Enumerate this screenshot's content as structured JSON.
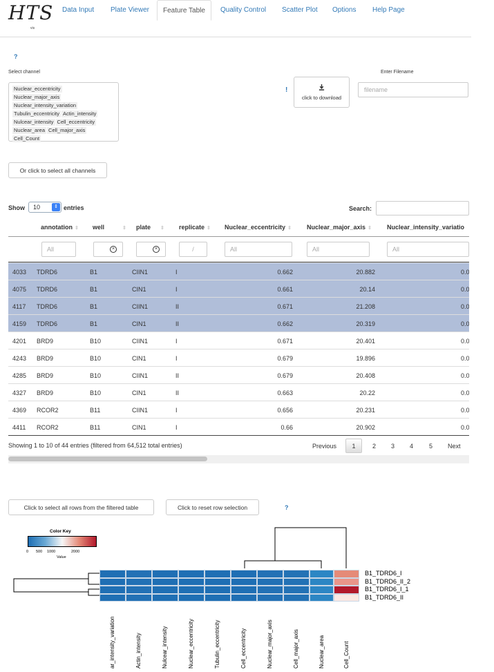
{
  "logo": {
    "main": "HTS",
    "sub": "vis"
  },
  "nav": {
    "items": [
      "Data Input",
      "Plate Viewer",
      "Feature Table",
      "Quality Control",
      "Scatter Plot",
      "Options",
      "Help Page"
    ],
    "active": "Feature Table"
  },
  "help": {
    "q1": "?",
    "q2": "?",
    "bang": "!"
  },
  "channel": {
    "label": "Select channel",
    "options": [
      "Nuclear_eccentricity",
      "Nuclear_major_axis",
      "Nuclear_intensity_variation",
      "Tubulin_eccentricity",
      "Actin_intensity",
      "Nulcear_intensity",
      "Cell_eccentricity",
      "Nuclear_area",
      "Cell_major_axis",
      "Cell_Count"
    ]
  },
  "download": {
    "label": "click to download",
    "icon": "download-icon"
  },
  "filename": {
    "label": "Enter Filename",
    "placeholder": "filename"
  },
  "select_all_channels": "Or click to select all channels",
  "table": {
    "show_label": "Show",
    "length_value": "10",
    "entries_label": "entries",
    "search_label": "Search:",
    "columns": [
      "annotation",
      "well",
      "plate",
      "replicate",
      "Nuclear_eccentricity",
      "Nuclear_major_axis",
      "Nuclear_intensity_variatio"
    ],
    "filters": [
      "All",
      "",
      "",
      "/",
      "All",
      "All",
      "All"
    ],
    "rows": [
      {
        "id": "4033",
        "annotation": "TDRD6",
        "well": "B1",
        "plate": "CIIN1",
        "replicate": "I",
        "ecc": "0.662",
        "major": "20.882",
        "var": "0.0",
        "selected": true
      },
      {
        "id": "4075",
        "annotation": "TDRD6",
        "well": "B1",
        "plate": "CIN1",
        "replicate": "I",
        "ecc": "0.661",
        "major": "20.14",
        "var": "0.0",
        "selected": true
      },
      {
        "id": "4117",
        "annotation": "TDRD6",
        "well": "B1",
        "plate": "CIIN1",
        "replicate": "II",
        "ecc": "0.671",
        "major": "21.208",
        "var": "0.0",
        "selected": true
      },
      {
        "id": "4159",
        "annotation": "TDRD6",
        "well": "B1",
        "plate": "CIN1",
        "replicate": "II",
        "ecc": "0.662",
        "major": "20.319",
        "var": "0.0",
        "selected": true
      },
      {
        "id": "4201",
        "annotation": "BRD9",
        "well": "B10",
        "plate": "CIIN1",
        "replicate": "I",
        "ecc": "0.671",
        "major": "20.401",
        "var": "0.0",
        "selected": false
      },
      {
        "id": "4243",
        "annotation": "BRD9",
        "well": "B10",
        "plate": "CIN1",
        "replicate": "I",
        "ecc": "0.679",
        "major": "19.896",
        "var": "0.0",
        "selected": false
      },
      {
        "id": "4285",
        "annotation": "BRD9",
        "well": "B10",
        "plate": "CIIN1",
        "replicate": "II",
        "ecc": "0.679",
        "major": "20.408",
        "var": "0.0",
        "selected": false
      },
      {
        "id": "4327",
        "annotation": "BRD9",
        "well": "B10",
        "plate": "CIN1",
        "replicate": "II",
        "ecc": "0.663",
        "major": "20.22",
        "var": "0.0",
        "selected": false
      },
      {
        "id": "4369",
        "annotation": "RCOR2",
        "well": "B11",
        "plate": "CIIN1",
        "replicate": "I",
        "ecc": "0.656",
        "major": "20.231",
        "var": "0.0",
        "selected": false
      },
      {
        "id": "4411",
        "annotation": "RCOR2",
        "well": "B11",
        "plate": "CIN1",
        "replicate": "I",
        "ecc": "0.66",
        "major": "20.902",
        "var": "0.0",
        "selected": false
      }
    ],
    "info": "Showing 1 to 10 of 44 entries (filtered from 64,512 total entries)",
    "pagination": {
      "previous": "Previous",
      "pages": [
        "1",
        "2",
        "3",
        "4",
        "5"
      ],
      "current": "1",
      "next": "Next"
    }
  },
  "row_buttons": {
    "select_all": "Click to select all rows from the filtered table",
    "reset": "Click to reset row selection"
  },
  "chart_data": {
    "type": "heatmap",
    "color_key": {
      "title": "Color Key",
      "xlabel": "Value",
      "ticks": [
        "0",
        "500",
        "1000",
        "2000"
      ],
      "range": [
        0,
        2500
      ],
      "low_color": "#1f6fb4",
      "mid_color": "#f7f7f7",
      "high_color": "#b2182b"
    },
    "columns": [
      "Nuclear_intensity_variation",
      "Actin_intensity",
      "Nulcear_intensity",
      "Nuclear_eccentricity",
      "Tubulin_eccentricity",
      "Cell_eccentricity",
      "Nuclear_major_axis",
      "Cell_major_axis",
      "Nuclear_area",
      "Cell_Count"
    ],
    "column_labels": [
      "ar_intensity_variation",
      "Actin_intensity",
      "Nulcear_intensity",
      "Nuclear_eccentricity",
      "Tubulin_eccentricity",
      "Cell_eccentricity",
      "Nuclear_major_axis",
      "Cell_major_axis",
      "Nuclear_area",
      "Cell_Count"
    ],
    "rows": [
      "B1_TDRD6_I",
      "B1_TDRD6_II_2",
      "B1_TDRD6_I_1",
      "B1_TDRD6_II"
    ],
    "values": [
      [
        0.7,
        20.9,
        1,
        0.66,
        0.7,
        0.7,
        20.9,
        25,
        300,
        1700
      ],
      [
        0.7,
        20.1,
        1,
        0.66,
        0.7,
        0.7,
        20.1,
        25,
        300,
        1800
      ],
      [
        0.7,
        21.2,
        1,
        0.67,
        0.7,
        0.7,
        21.2,
        25,
        300,
        2500
      ],
      [
        0.7,
        20.3,
        1,
        0.66,
        0.7,
        0.7,
        20.3,
        25,
        300,
        1300
      ]
    ]
  }
}
